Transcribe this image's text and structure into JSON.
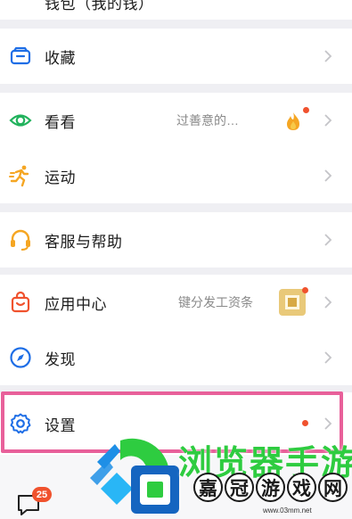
{
  "menu": {
    "top_partial_label": "钱包（我的钱）",
    "favorites": {
      "label": "收藏"
    },
    "watch": {
      "label": "看看",
      "subtitle": "过善意的…"
    },
    "sport": {
      "label": "运动"
    },
    "service": {
      "label": "客服与帮助"
    },
    "apps": {
      "label": "应用中心",
      "subtitle": "键分发工资条"
    },
    "discover": {
      "label": "发现"
    },
    "settings": {
      "label": "设置"
    }
  },
  "bottom_nav": {
    "message_badge": "25"
  },
  "watermark": {
    "title": "浏览器手游",
    "chars": [
      "嘉",
      "冠",
      "游",
      "戏",
      "网"
    ],
    "url": "www.03mm.net"
  },
  "colors": {
    "accent_blue": "#1e6ee6",
    "watch_green": "#21b25c",
    "sport_orange": "#f5a623",
    "notification_red": "#f0522e",
    "highlight_pink": "#e8609a"
  },
  "icons": {
    "favorites": "folder-icon",
    "watch": "eye-icon",
    "sport": "running-icon",
    "service": "headset-icon",
    "apps": "shopping-bag-icon",
    "discover": "compass-icon",
    "settings": "gear-icon",
    "watch_badge": "fire-icon",
    "apps_badge": "mini-program-icon",
    "messages": "chat-icon"
  }
}
